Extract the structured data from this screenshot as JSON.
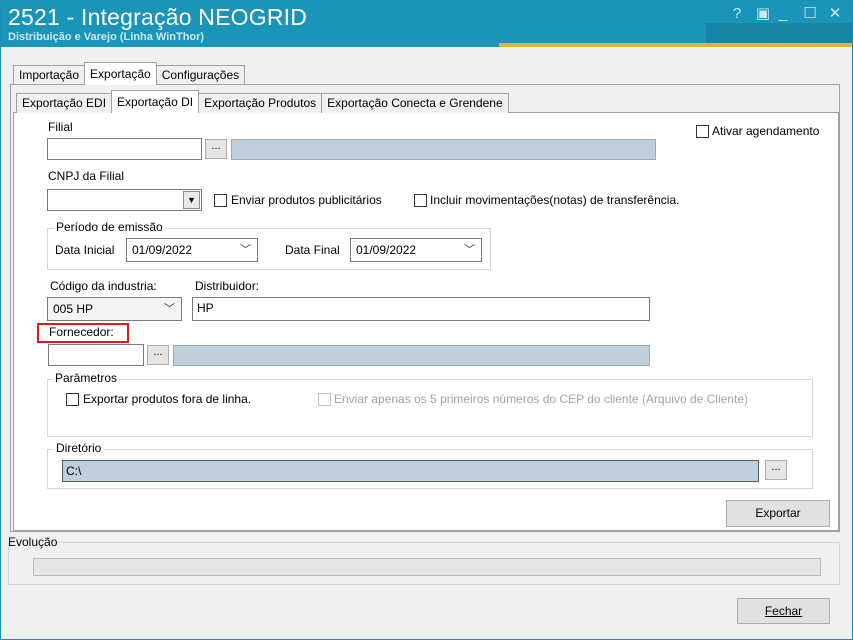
{
  "window": {
    "title": "2521 - Integração NEOGRID",
    "subtitle": "Distribuição e Varejo (Linha WinThor)",
    "controls": {
      "help": "?",
      "restore": "▣",
      "minimize": "_",
      "maximize": "☐",
      "close": "✕"
    }
  },
  "main_tabs": [
    "Importação",
    "Exportação",
    "Configurações"
  ],
  "sub_tabs": [
    "Exportação EDI",
    "Exportação DI",
    "Exportação Produtos",
    "Exportação Conecta e Grendene"
  ],
  "form": {
    "filial_label": "Filial",
    "filial_value": "",
    "filial_button": "...",
    "ativar_agendamento": "Ativar agendamento",
    "cnpj_label": "CNPJ da Filial",
    "cnpj_value": "",
    "enviar_publicitarios": "Enviar produtos publicitários",
    "incluir_movimentacoes": "Incluir movimentações(notas) de transferência.",
    "periodo": {
      "title": "Período de emissão",
      "data_inicial_label": "Data Inicial",
      "data_inicial_value": "01/09/2022",
      "data_final_label": "Data Final",
      "data_final_value": "01/09/2022"
    },
    "codigo_industria_label": "Código da industria:",
    "codigo_industria_value": "005 HP",
    "distribuidor_label": "Distribuidor:",
    "distribuidor_value": "HP",
    "fornecedor_label": "Fornecedor:",
    "fornecedor_value": "",
    "fornecedor_button": "...",
    "parametros": {
      "title": "Parâmetros",
      "exportar_fora_linha": "Exportar produtos fora de linha.",
      "enviar_cep": "Enviar apenas os 5 primeiros números do CEP do cliente (Arquivo de Cliente)"
    },
    "diretorio": {
      "title": "Diretório",
      "value": "C:\\",
      "button": "..."
    },
    "exportar_button": "Exportar"
  },
  "evolucao": {
    "title": "Evolução",
    "progress": 0
  },
  "fechar_button": "Fechar",
  "colors": {
    "title_bar": "#1a94b8",
    "highlight": "#e0191e",
    "readonly_field": "#bfcedb"
  }
}
